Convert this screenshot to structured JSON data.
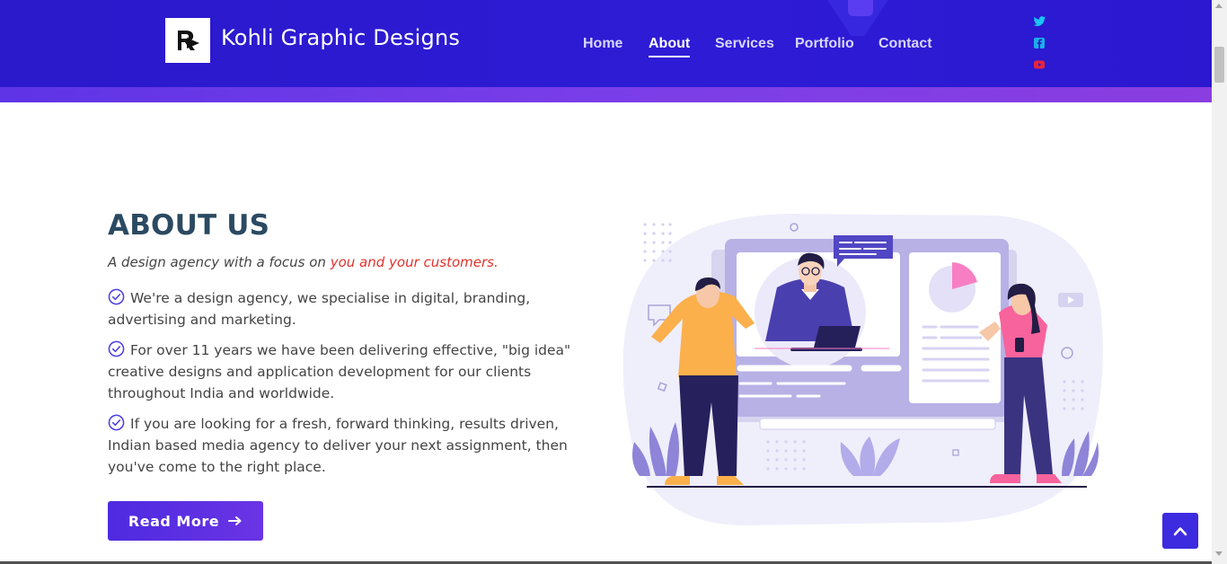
{
  "brand": {
    "name": "Kohli Graphic Designs"
  },
  "nav": {
    "items": [
      {
        "label": "Home",
        "active": false
      },
      {
        "label": "About",
        "active": true
      },
      {
        "label": "Services",
        "active": false
      },
      {
        "label": "Portfolio",
        "active": false
      },
      {
        "label": "Contact",
        "active": false
      }
    ]
  },
  "social": {
    "icons": [
      "twitter-icon",
      "facebook-icon",
      "youtube-icon"
    ]
  },
  "about": {
    "title": "ABOUT US",
    "tagline_prefix": "A design agency with a focus on ",
    "tagline_accent": "you and your customers.",
    "points": [
      "We're a design agency, we specialise in digital, branding, advertising and marketing.",
      "For over 11 years we have been delivering effective, \"big idea\" creative designs and application development for our clients throughout India and worldwide.",
      "If you are looking for a fresh, forward thinking, results driven, Indian based media agency to deliver your next assignment, then you've come to the right place."
    ],
    "read_more_label": "Read More"
  },
  "colors": {
    "header_bg": "#2b1ad1",
    "accent_red": "#e2322c",
    "title": "#2b4a62",
    "button": "#5a2fe2"
  }
}
